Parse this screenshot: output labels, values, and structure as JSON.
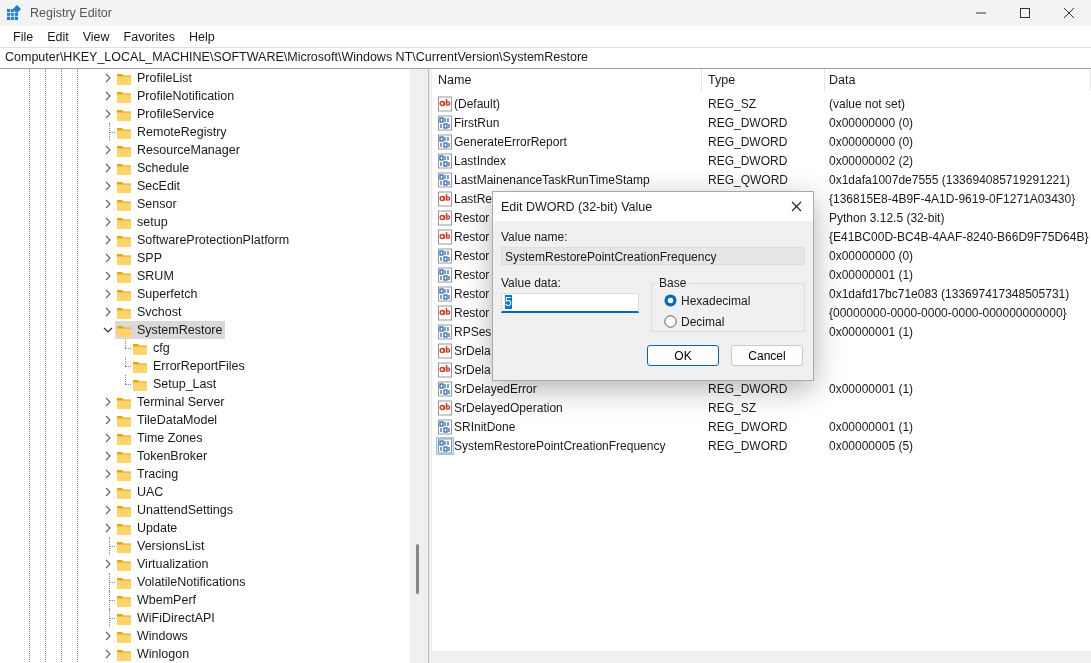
{
  "window": {
    "title": "Registry Editor"
  },
  "menu": [
    "File",
    "Edit",
    "View",
    "Favorites",
    "Help"
  ],
  "address": "Computer\\HKEY_LOCAL_MACHINE\\SOFTWARE\\Microsoft\\Windows NT\\CurrentVersion\\SystemRestore",
  "tree": [
    {
      "label": "ProfileList",
      "expandable": true,
      "expanded": false,
      "selected": false
    },
    {
      "label": "ProfileNotification",
      "expandable": true,
      "expanded": false,
      "selected": false
    },
    {
      "label": "ProfileService",
      "expandable": true,
      "expanded": false,
      "selected": false
    },
    {
      "label": "RemoteRegistry",
      "expandable": false,
      "selected": false
    },
    {
      "label": "ResourceManager",
      "expandable": true,
      "expanded": false,
      "selected": false
    },
    {
      "label": "Schedule",
      "expandable": true,
      "expanded": false,
      "selected": false
    },
    {
      "label": "SecEdit",
      "expandable": true,
      "expanded": false,
      "selected": false
    },
    {
      "label": "Sensor",
      "expandable": true,
      "expanded": false,
      "selected": false
    },
    {
      "label": "setup",
      "expandable": true,
      "expanded": false,
      "selected": false
    },
    {
      "label": "SoftwareProtectionPlatform",
      "expandable": true,
      "expanded": false,
      "selected": false
    },
    {
      "label": "SPP",
      "expandable": true,
      "expanded": false,
      "selected": false
    },
    {
      "label": "SRUM",
      "expandable": true,
      "expanded": false,
      "selected": false
    },
    {
      "label": "Superfetch",
      "expandable": true,
      "expanded": false,
      "selected": false
    },
    {
      "label": "Svchost",
      "expandable": true,
      "expanded": false,
      "selected": false
    },
    {
      "label": "SystemRestore",
      "expandable": true,
      "expanded": true,
      "selected": true,
      "children": [
        {
          "label": "cfg",
          "selected": false
        },
        {
          "label": "ErrorReportFiles",
          "selected": false
        },
        {
          "label": "Setup_Last",
          "selected": false
        }
      ]
    },
    {
      "label": "Terminal Server",
      "expandable": true,
      "expanded": false,
      "selected": false
    },
    {
      "label": "TileDataModel",
      "expandable": true,
      "expanded": false,
      "selected": false
    },
    {
      "label": "Time Zones",
      "expandable": true,
      "expanded": false,
      "selected": false
    },
    {
      "label": "TokenBroker",
      "expandable": true,
      "expanded": false,
      "selected": false
    },
    {
      "label": "Tracing",
      "expandable": true,
      "expanded": false,
      "selected": false
    },
    {
      "label": "UAC",
      "expandable": true,
      "expanded": false,
      "selected": false
    },
    {
      "label": "UnattendSettings",
      "expandable": true,
      "expanded": false,
      "selected": false
    },
    {
      "label": "Update",
      "expandable": true,
      "expanded": false,
      "selected": false
    },
    {
      "label": "VersionsList",
      "expandable": false,
      "selected": false
    },
    {
      "label": "Virtualization",
      "expandable": true,
      "expanded": false,
      "selected": false
    },
    {
      "label": "VolatileNotifications",
      "expandable": false,
      "selected": false
    },
    {
      "label": "WbemPerf",
      "expandable": false,
      "selected": false
    },
    {
      "label": "WiFiDirectAPI",
      "expandable": false,
      "selected": false
    },
    {
      "label": "Windows",
      "expandable": true,
      "expanded": false,
      "selected": false
    },
    {
      "label": "Winlogon",
      "expandable": true,
      "expanded": false,
      "selected": false
    }
  ],
  "list": {
    "columns": [
      "Name",
      "Type",
      "Data"
    ],
    "rows": [
      {
        "kind": "string",
        "name": "(Default)",
        "type": "REG_SZ",
        "data": "(value not set)",
        "selected": false
      },
      {
        "kind": "binary",
        "name": "FirstRun",
        "type": "REG_DWORD",
        "data": "0x00000000 (0)",
        "selected": false
      },
      {
        "kind": "binary",
        "name": "GenerateErrorReport",
        "type": "REG_DWORD",
        "data": "0x00000000 (0)",
        "selected": false
      },
      {
        "kind": "binary",
        "name": "LastIndex",
        "type": "REG_DWORD",
        "data": "0x00000002 (2)",
        "selected": false
      },
      {
        "kind": "binary",
        "name": "LastMainenanceTaskRunTimeStamp",
        "type": "REG_QWORD",
        "data": "0x1dafa1007de7555 (133694085719291221)",
        "selected": false
      },
      {
        "kind": "string",
        "name": "LastRe",
        "data": "{136815E8-4B9F-4A1D-9619-0F1271A03430}",
        "selected": false
      },
      {
        "kind": "string",
        "name": "Restor",
        "data": "Python 3.12.5 (32-bit)",
        "selected": false
      },
      {
        "kind": "string",
        "name": "Restor",
        "data": "{E41BC00D-BC4B-4AAF-8240-B66D9F75D64B}",
        "selected": false
      },
      {
        "kind": "binary",
        "name": "Restor",
        "data": "0x00000000 (0)",
        "selected": false
      },
      {
        "kind": "binary",
        "name": "Restor",
        "data": "0x00000001 (1)",
        "selected": false
      },
      {
        "kind": "binary",
        "name": "Restor",
        "data": "0x1dafd17bc71e083 (133697417348505731)",
        "selected": false
      },
      {
        "kind": "string",
        "name": "Restor",
        "data": "{00000000-0000-0000-0000-000000000000}",
        "selected": false
      },
      {
        "kind": "binary",
        "name": "RPSes",
        "data": "0x00000001 (1)",
        "selected": false
      },
      {
        "kind": "string",
        "name": "SrDela",
        "selected": false
      },
      {
        "kind": "string",
        "name": "SrDela",
        "selected": false
      },
      {
        "kind": "binary",
        "name": "SrDelayedError",
        "type": "REG_DWORD",
        "data": "0x00000001 (1)",
        "selected": false
      },
      {
        "kind": "string",
        "name": "SrDelayedOperation",
        "type": "REG_SZ",
        "selected": false
      },
      {
        "kind": "binary",
        "name": "SRInitDone",
        "type": "REG_DWORD",
        "data": "0x00000001 (1)",
        "selected": false
      },
      {
        "kind": "binary",
        "name": "SystemRestorePointCreationFrequency",
        "type": "REG_DWORD",
        "data": "0x00000005 (5)",
        "selected": true
      }
    ]
  },
  "dialog": {
    "title": "Edit DWORD (32-bit) Value",
    "value_name_label": "Value name:",
    "value_name": "SystemRestorePointCreationFrequency",
    "value_data_label": "Value data:",
    "value_data": "5",
    "base_label": "Base",
    "base_options": [
      {
        "label": "Hexadecimal",
        "selected": true
      },
      {
        "label": "Decimal",
        "selected": false
      }
    ],
    "buttons": [
      {
        "label": "OK",
        "default": true
      },
      {
        "label": "Cancel",
        "default": false
      }
    ]
  }
}
